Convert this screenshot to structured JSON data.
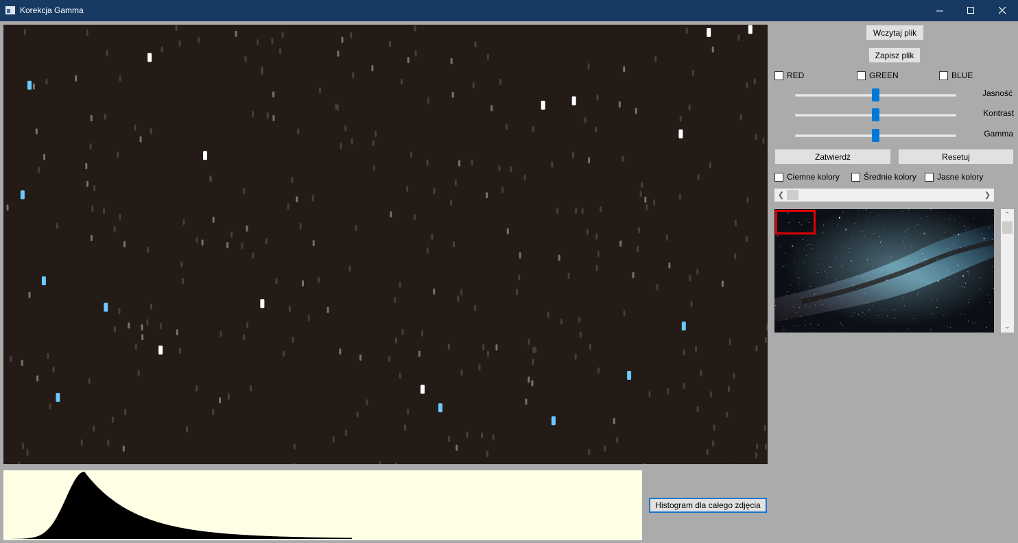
{
  "window": {
    "title": "Korekcja Gamma",
    "icons": {
      "minimize": "minimize-icon",
      "maximize": "maximize-icon",
      "close": "close-icon"
    }
  },
  "controls": {
    "load_label": "Wczytaj plik",
    "save_label": "Zapisz plik",
    "channels": [
      {
        "label": "RED",
        "checked": false
      },
      {
        "label": "GREEN",
        "checked": false
      },
      {
        "label": "BLUE",
        "checked": false
      }
    ],
    "sliders": [
      {
        "label": "Jasność",
        "value": 0.5
      },
      {
        "label": "Kontrast",
        "value": 0.5
      },
      {
        "label": "Gamma",
        "value": 0.5
      }
    ],
    "apply_label": "Zatwierdź",
    "reset_label": "Resetuj",
    "tone_ranges": [
      {
        "label": "Ciemne kolory",
        "checked": false
      },
      {
        "label": "Średnie kolory",
        "checked": false
      },
      {
        "label": "Jasne kolory",
        "checked": false
      }
    ]
  },
  "histogram": {
    "button_label": "Histogram dla całego zdjęcia",
    "bar_color": "#000000",
    "background": "#ffffe5"
  },
  "colors": {
    "titlebar": "#173a63",
    "window_bg": "#ababab",
    "accent": "#0078d7",
    "viewport_frame": "#e00000"
  }
}
